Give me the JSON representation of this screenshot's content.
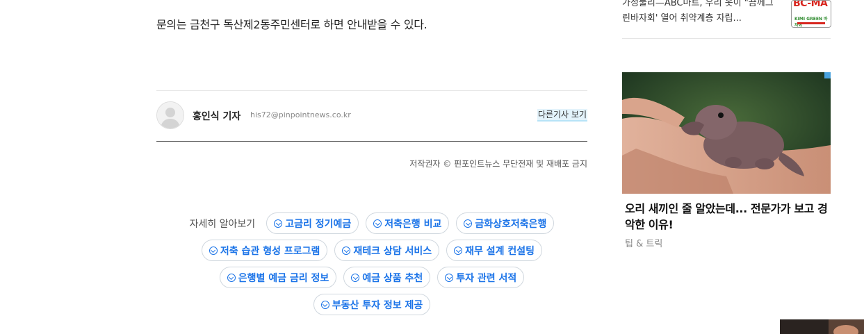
{
  "article": {
    "closing_text": "문의는 금천구 독산제2동주민센터로 하면 안내받을 수 있다."
  },
  "author": {
    "name": "홍인식 기자",
    "email": "his72@pinpointnews.co.kr",
    "more_link": "다른기사 보기",
    "avatar_icon": "user-avatar-icon"
  },
  "copyright": "저작권자 © 핀포인트뉴스 무단전재 및 재배포 금지",
  "related": {
    "label": "자세히 알아보기",
    "chip_icon": "arrow-circle-icon",
    "rows": [
      [
        "고금리 정기예금",
        "저축은행 비교",
        "금화상호저축은행"
      ],
      [
        "저축 습관 형성 프로그램",
        "재테크 상담 서비스",
        "재무 설계 컨설팅"
      ],
      [
        "은행별 예금 금리 정보",
        "예금 상품 추천",
        "투자 관련 서적"
      ],
      [
        "부동산 투자 정보 제공"
      ]
    ],
    "accent_color": "#1a73e8"
  },
  "sidebar": {
    "news_item": {
      "text": "가성물리—ABC마트, 우리 옷이 \"끔께그린바자회' 열어 취약계층 자립...",
      "thumb_title": "BC-MA",
      "thumb_sub": "KIMI GREEN 바자회"
    },
    "ad": {
      "title": "오리 새끼인 줄 알았는데... 전문가가 보고 경악한 이유!",
      "source": "팁 & 트릭",
      "image_desc_icon": "baby-platypus-photo"
    }
  }
}
